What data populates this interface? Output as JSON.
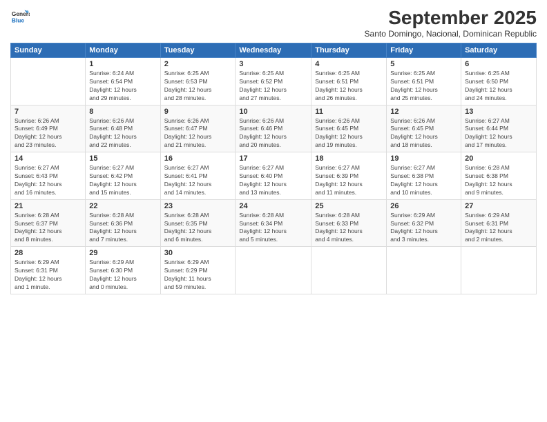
{
  "logo": {
    "line1": "General",
    "line2": "Blue"
  },
  "title": "September 2025",
  "subtitle": "Santo Domingo, Nacional, Dominican Republic",
  "days_header": [
    "Sunday",
    "Monday",
    "Tuesday",
    "Wednesday",
    "Thursday",
    "Friday",
    "Saturday"
  ],
  "weeks": [
    [
      {
        "num": "",
        "info": ""
      },
      {
        "num": "1",
        "info": "Sunrise: 6:24 AM\nSunset: 6:54 PM\nDaylight: 12 hours\nand 29 minutes."
      },
      {
        "num": "2",
        "info": "Sunrise: 6:25 AM\nSunset: 6:53 PM\nDaylight: 12 hours\nand 28 minutes."
      },
      {
        "num": "3",
        "info": "Sunrise: 6:25 AM\nSunset: 6:52 PM\nDaylight: 12 hours\nand 27 minutes."
      },
      {
        "num": "4",
        "info": "Sunrise: 6:25 AM\nSunset: 6:51 PM\nDaylight: 12 hours\nand 26 minutes."
      },
      {
        "num": "5",
        "info": "Sunrise: 6:25 AM\nSunset: 6:51 PM\nDaylight: 12 hours\nand 25 minutes."
      },
      {
        "num": "6",
        "info": "Sunrise: 6:25 AM\nSunset: 6:50 PM\nDaylight: 12 hours\nand 24 minutes."
      }
    ],
    [
      {
        "num": "7",
        "info": "Sunrise: 6:26 AM\nSunset: 6:49 PM\nDaylight: 12 hours\nand 23 minutes."
      },
      {
        "num": "8",
        "info": "Sunrise: 6:26 AM\nSunset: 6:48 PM\nDaylight: 12 hours\nand 22 minutes."
      },
      {
        "num": "9",
        "info": "Sunrise: 6:26 AM\nSunset: 6:47 PM\nDaylight: 12 hours\nand 21 minutes."
      },
      {
        "num": "10",
        "info": "Sunrise: 6:26 AM\nSunset: 6:46 PM\nDaylight: 12 hours\nand 20 minutes."
      },
      {
        "num": "11",
        "info": "Sunrise: 6:26 AM\nSunset: 6:45 PM\nDaylight: 12 hours\nand 19 minutes."
      },
      {
        "num": "12",
        "info": "Sunrise: 6:26 AM\nSunset: 6:45 PM\nDaylight: 12 hours\nand 18 minutes."
      },
      {
        "num": "13",
        "info": "Sunrise: 6:27 AM\nSunset: 6:44 PM\nDaylight: 12 hours\nand 17 minutes."
      }
    ],
    [
      {
        "num": "14",
        "info": "Sunrise: 6:27 AM\nSunset: 6:43 PM\nDaylight: 12 hours\nand 16 minutes."
      },
      {
        "num": "15",
        "info": "Sunrise: 6:27 AM\nSunset: 6:42 PM\nDaylight: 12 hours\nand 15 minutes."
      },
      {
        "num": "16",
        "info": "Sunrise: 6:27 AM\nSunset: 6:41 PM\nDaylight: 12 hours\nand 14 minutes."
      },
      {
        "num": "17",
        "info": "Sunrise: 6:27 AM\nSunset: 6:40 PM\nDaylight: 12 hours\nand 13 minutes."
      },
      {
        "num": "18",
        "info": "Sunrise: 6:27 AM\nSunset: 6:39 PM\nDaylight: 12 hours\nand 11 minutes."
      },
      {
        "num": "19",
        "info": "Sunrise: 6:27 AM\nSunset: 6:38 PM\nDaylight: 12 hours\nand 10 minutes."
      },
      {
        "num": "20",
        "info": "Sunrise: 6:28 AM\nSunset: 6:38 PM\nDaylight: 12 hours\nand 9 minutes."
      }
    ],
    [
      {
        "num": "21",
        "info": "Sunrise: 6:28 AM\nSunset: 6:37 PM\nDaylight: 12 hours\nand 8 minutes."
      },
      {
        "num": "22",
        "info": "Sunrise: 6:28 AM\nSunset: 6:36 PM\nDaylight: 12 hours\nand 7 minutes."
      },
      {
        "num": "23",
        "info": "Sunrise: 6:28 AM\nSunset: 6:35 PM\nDaylight: 12 hours\nand 6 minutes."
      },
      {
        "num": "24",
        "info": "Sunrise: 6:28 AM\nSunset: 6:34 PM\nDaylight: 12 hours\nand 5 minutes."
      },
      {
        "num": "25",
        "info": "Sunrise: 6:28 AM\nSunset: 6:33 PM\nDaylight: 12 hours\nand 4 minutes."
      },
      {
        "num": "26",
        "info": "Sunrise: 6:29 AM\nSunset: 6:32 PM\nDaylight: 12 hours\nand 3 minutes."
      },
      {
        "num": "27",
        "info": "Sunrise: 6:29 AM\nSunset: 6:31 PM\nDaylight: 12 hours\nand 2 minutes."
      }
    ],
    [
      {
        "num": "28",
        "info": "Sunrise: 6:29 AM\nSunset: 6:31 PM\nDaylight: 12 hours\nand 1 minute."
      },
      {
        "num": "29",
        "info": "Sunrise: 6:29 AM\nSunset: 6:30 PM\nDaylight: 12 hours\nand 0 minutes."
      },
      {
        "num": "30",
        "info": "Sunrise: 6:29 AM\nSunset: 6:29 PM\nDaylight: 11 hours\nand 59 minutes."
      },
      {
        "num": "",
        "info": ""
      },
      {
        "num": "",
        "info": ""
      },
      {
        "num": "",
        "info": ""
      },
      {
        "num": "",
        "info": ""
      }
    ]
  ]
}
